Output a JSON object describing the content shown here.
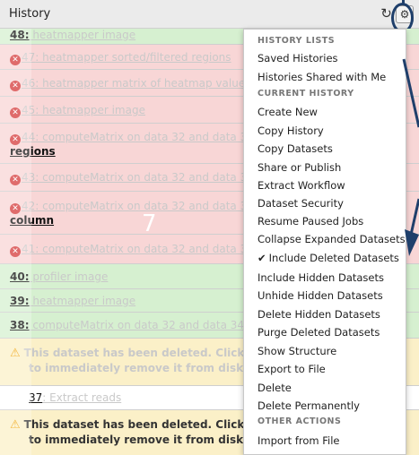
{
  "header": {
    "title": "History",
    "refresh_icon": "refresh-icon",
    "gear_icon": "gear-icon"
  },
  "items": [
    {
      "num": "48:",
      "title": " heatmapper image",
      "state": "green"
    },
    {
      "num": "47",
      "title": ": heatmapper sorted/filtered regions",
      "state": "red"
    },
    {
      "num": "46",
      "title": ": heatmapper matrix of heatmap values",
      "state": "red"
    },
    {
      "num": "45",
      "title": ": heatmapper image",
      "state": "red"
    },
    {
      "num": "44",
      "title": ": computeMatrix on data 32 and data 34:",
      "wrap": "regions",
      "state": "red"
    },
    {
      "num": "43",
      "title": ": computeMatrix on data 32 and data 34",
      "state": "red"
    },
    {
      "num": "42",
      "title": ": computeMatrix on data 32 and data 34",
      "wrap": "column",
      "state": "red"
    },
    {
      "num": "41",
      "title": ": computeMatrix on data 32 and data 34",
      "state": "red"
    },
    {
      "num": "40:",
      "title": " profiler image",
      "state": "green"
    },
    {
      "num": "39:",
      "title": " heatmapper image",
      "state": "green"
    },
    {
      "num": "38:",
      "title": " computeMatrix on data 32 and data 34:",
      "state": "green"
    }
  ],
  "deleted_notice": {
    "line1": "This dataset has been deleted. Click",
    "line2": "to immediately remove it from disk"
  },
  "item37": {
    "num": "37",
    "title": ": Extract reads"
  },
  "mark": "7",
  "menu": {
    "history_lists_header": "HISTORY LISTS",
    "saved_histories": "Saved Histories",
    "histories_shared": "Histories Shared with Me",
    "current_history_header": "CURRENT HISTORY",
    "create_new": "Create New",
    "copy_history": "Copy History",
    "copy_datasets": "Copy Datasets",
    "share_or_publish": "Share or Publish",
    "extract_workflow": "Extract Workflow",
    "dataset_security": "Dataset Security",
    "resume_paused_jobs": "Resume Paused Jobs",
    "collapse_expanded": "Collapse Expanded Datasets",
    "include_deleted": "Include Deleted Datasets",
    "include_hidden": "Include Hidden Datasets",
    "unhide_hidden": "Unhide Hidden Datasets",
    "delete_hidden": "Delete Hidden Datasets",
    "purge_deleted": "Purge Deleted Datasets",
    "show_structure": "Show Structure",
    "export_to_file": "Export to File",
    "delete": "Delete",
    "delete_permanently": "Delete Permanently",
    "other_actions_header": "OTHER ACTIONS",
    "import_from_file": "Import from File"
  },
  "colors": {
    "deleted_bg": "#f8d6d6",
    "ok_bg": "#d6f0d0",
    "warning_bg": "#fbf0c8",
    "annotation": "#1f3f6b"
  }
}
